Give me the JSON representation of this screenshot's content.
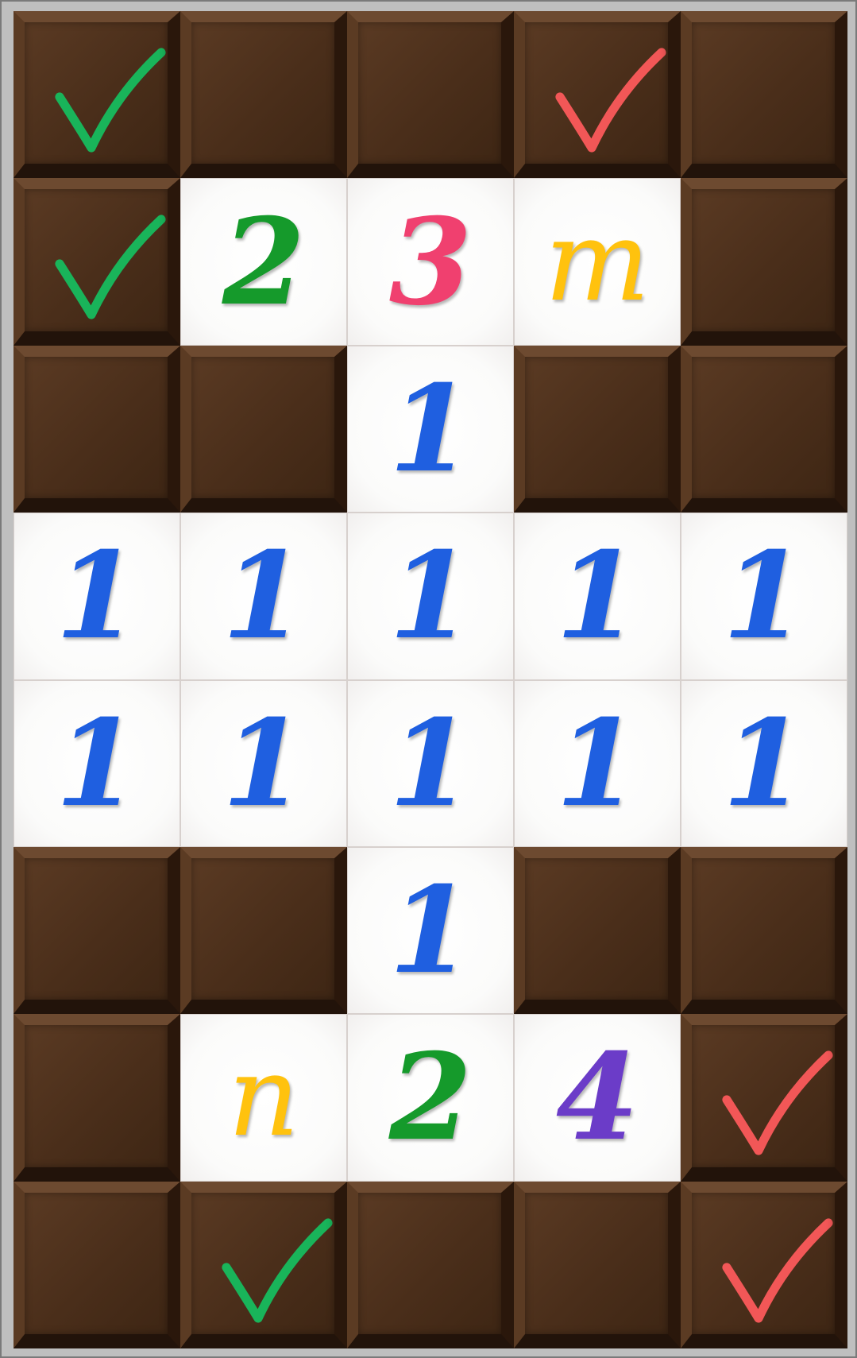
{
  "grid": {
    "columns": 5,
    "rows": 8
  },
  "colors": {
    "1": "#1f5fe0",
    "2": "#159a2b",
    "3": "#f0406f",
    "4": "#6b3cc8",
    "m": "#ffc20e",
    "n": "#ffc20e",
    "check_green": "#19b45a",
    "check_red": "#f25757"
  },
  "cells": [
    [
      "",
      "",
      "",
      "",
      ""
    ],
    [
      "",
      "2",
      "3",
      "m",
      ""
    ],
    [
      "",
      "",
      "1",
      "",
      ""
    ],
    [
      "1",
      "1",
      "1",
      "1",
      "1"
    ],
    [
      "1",
      "1",
      "1",
      "1",
      "1"
    ],
    [
      "",
      "",
      "1",
      "",
      ""
    ],
    [
      "",
      "n",
      "2",
      "4",
      ""
    ],
    [
      "",
      "",
      "",
      "",
      ""
    ]
  ],
  "checkmarks": [
    {
      "row": 0,
      "col": 0,
      "color": "green"
    },
    {
      "row": 0,
      "col": 3,
      "color": "red"
    },
    {
      "row": 1,
      "col": 0,
      "color": "green"
    },
    {
      "row": 6,
      "col": 4,
      "color": "red"
    },
    {
      "row": 7,
      "col": 1,
      "color": "green"
    },
    {
      "row": 7,
      "col": 4,
      "color": "red"
    }
  ]
}
